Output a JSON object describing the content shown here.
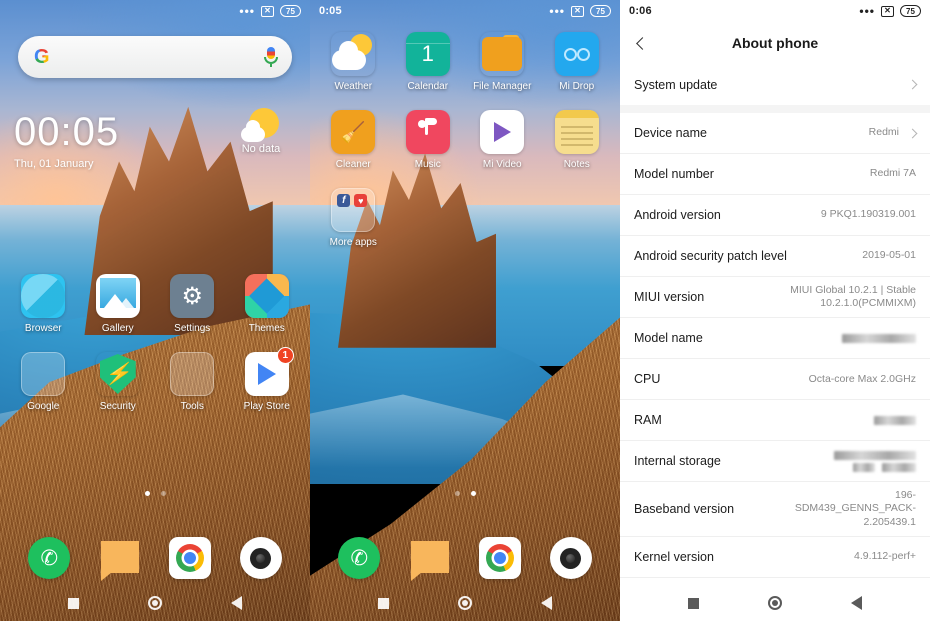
{
  "panels": {
    "home": {
      "status": {
        "time": "",
        "icons": [
          "more-dots",
          "no-sim",
          "battery"
        ],
        "battery": "75"
      },
      "clock": {
        "time": "00:05",
        "date": "Thu, 01 January"
      },
      "weather": {
        "text": "No data",
        "icon": "sun-cloud-icon"
      },
      "search": {
        "placeholder": "",
        "logo": "G",
        "mic": "mic-icon"
      },
      "apps_row1": [
        {
          "label": "Browser",
          "icon": "browser-icon"
        },
        {
          "label": "Gallery",
          "icon": "gallery-icon"
        },
        {
          "label": "Settings",
          "icon": "settings-gear-icon"
        },
        {
          "label": "Themes",
          "icon": "themes-icon"
        }
      ],
      "apps_row2": [
        {
          "label": "Google",
          "icon": "google-folder-icon"
        },
        {
          "label": "Security",
          "icon": "security-shield-icon"
        },
        {
          "label": "Tools",
          "icon": "tools-folder-icon"
        },
        {
          "label": "Play Store",
          "icon": "play-store-icon",
          "badge": "1"
        }
      ],
      "dots": {
        "count": 2,
        "active": 0
      },
      "dock": [
        {
          "label": "Phone",
          "icon": "phone-icon"
        },
        {
          "label": "Messaging",
          "icon": "message-icon"
        },
        {
          "label": "Chrome",
          "icon": "chrome-icon"
        },
        {
          "label": "Camera",
          "icon": "camera-icon"
        }
      ],
      "nav": [
        "recents-icon",
        "home-icon",
        "back-icon"
      ]
    },
    "mid": {
      "status": {
        "time": "0:05",
        "battery": "75"
      },
      "apps_row1": [
        {
          "label": "Weather",
          "icon": "weather-icon"
        },
        {
          "label": "Calendar",
          "icon": "calendar-icon",
          "day": "1"
        },
        {
          "label": "File Manager",
          "icon": "file-manager-icon"
        },
        {
          "label": "Mi Drop",
          "icon": "mi-drop-icon"
        }
      ],
      "apps_row2": [
        {
          "label": "Cleaner",
          "icon": "cleaner-icon"
        },
        {
          "label": "Music",
          "icon": "music-icon"
        },
        {
          "label": "Mi Video",
          "icon": "mi-video-icon"
        },
        {
          "label": "Notes",
          "icon": "notes-icon"
        }
      ],
      "apps_row3": [
        {
          "label": "More apps",
          "icon": "more-apps-folder-icon"
        }
      ],
      "dots": {
        "count": 2,
        "active": 1
      },
      "dock": [
        {
          "label": "Phone",
          "icon": "phone-icon"
        },
        {
          "label": "Messaging",
          "icon": "message-icon"
        },
        {
          "label": "Chrome",
          "icon": "chrome-icon"
        },
        {
          "label": "Camera",
          "icon": "camera-icon"
        }
      ]
    },
    "settings": {
      "status": {
        "time": "0:06",
        "battery": "75"
      },
      "header": {
        "title": "About phone",
        "back": "back-chevron-icon"
      },
      "rows": [
        {
          "key": "System update",
          "value": "",
          "chevron": true,
          "redacted": false
        },
        {
          "key": "Device name",
          "value": "Redmi",
          "chevron": true,
          "redacted": false
        },
        {
          "key": "Model number",
          "value": "Redmi 7A",
          "chevron": false,
          "redacted": false
        },
        {
          "key": "Android version",
          "value": "9 PKQ1.190319.001",
          "chevron": false,
          "redacted": false
        },
        {
          "key": "Android security patch level",
          "value": "2019-05-01",
          "chevron": false,
          "redacted": false
        },
        {
          "key": "MIUI version",
          "value": "MIUI Global 10.2.1 | Stable\n10.2.1.0(PCMMIXM)",
          "chevron": false,
          "redacted": false
        },
        {
          "key": "Model name",
          "value": "",
          "chevron": false,
          "redacted": true
        },
        {
          "key": "CPU",
          "value": "Octa-core Max 2.0GHz",
          "chevron": false,
          "redacted": false
        },
        {
          "key": "RAM",
          "value": "",
          "chevron": false,
          "redacted": true
        },
        {
          "key": "Internal storage",
          "value": "",
          "chevron": false,
          "redacted": true
        },
        {
          "key": "Baseband version",
          "value": "196-\nSDM439_GENNS_PACK-\n2.205439.1",
          "chevron": false,
          "redacted": false
        },
        {
          "key": "Kernel version",
          "value": "4.9.112-perf+",
          "chevron": false,
          "redacted": false
        }
      ],
      "nav": [
        "recents-icon",
        "home-icon",
        "back-icon"
      ]
    }
  },
  "colors": {
    "accent_green": "#1ec05e",
    "accent_orange": "#f0a01e",
    "badge_red": "#f04322",
    "settings_bg": "#ffffff",
    "divider": "#efefef"
  }
}
